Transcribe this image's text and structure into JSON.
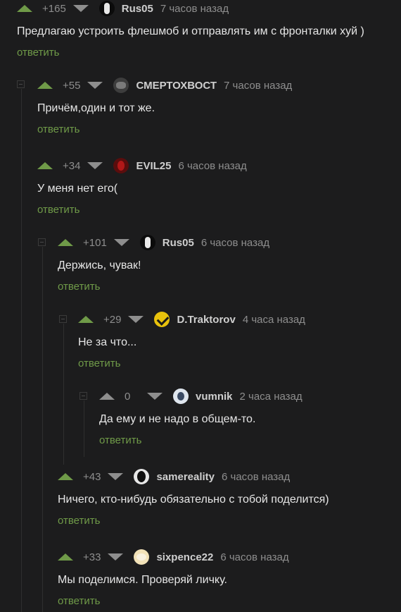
{
  "reply_label": "ответить",
  "comments": [
    {
      "rating": "+165",
      "user": "Rus05",
      "time": "7 часов назад",
      "text": "Предлагаю устроить флешмоб и отправлять им с фронталки хуй )",
      "avatar": "rus05-avatar-icon"
    },
    {
      "rating": "+55",
      "user": "СМЕРТОХВОСТ",
      "time": "7 часов назад",
      "text": "Причём,один и тот же.",
      "avatar": "smertokhvost-avatar-icon"
    },
    {
      "rating": "+34",
      "user": "EVIL25",
      "time": "6 часов назад",
      "text": "У меня нет его(",
      "avatar": "evil25-avatar-icon"
    },
    {
      "rating": "+101",
      "user": "Rus05",
      "time": "6 часов назад",
      "text": "Держись, чувак!",
      "avatar": "rus05-avatar-icon"
    },
    {
      "rating": "+29",
      "user": "D.Traktorov",
      "time": "4 часа назад",
      "text": "Не за что...",
      "avatar": "dtraktorov-avatar-icon"
    },
    {
      "rating": "0",
      "user": "vumnik",
      "time": "2 часа назад",
      "text": "Да ему и не надо в общем-то.",
      "avatar": "vumnik-avatar-icon"
    },
    {
      "rating": "+43",
      "user": "samereality",
      "time": "6 часов назад",
      "text": "Ничего, кто-нибудь обязательно с тобой поделится)",
      "avatar": "samereality-avatar-icon"
    },
    {
      "rating": "+33",
      "user": "sixpence22",
      "time": "6 часов назад",
      "text": "Мы поделимся. Проверяй личку.",
      "avatar": "sixpence22-avatar-icon"
    }
  ],
  "colors": {
    "upvote": "#6f9a48",
    "reply": "#6f9a48",
    "background": "#1c1c1d",
    "muted": "#8e8e8e"
  }
}
